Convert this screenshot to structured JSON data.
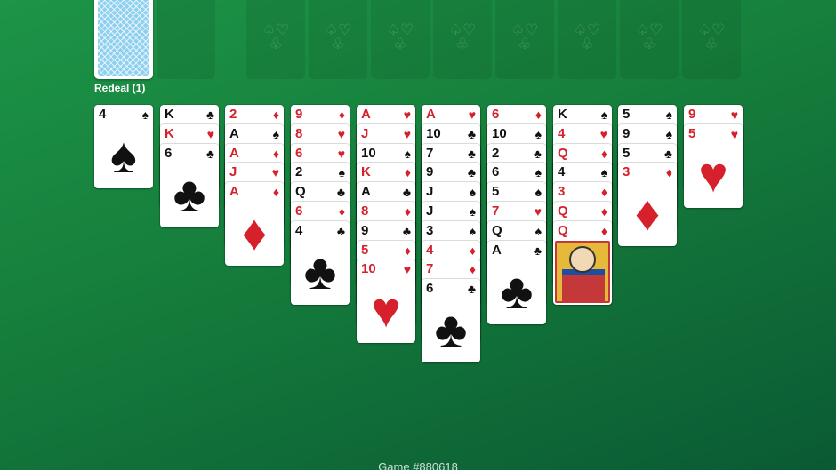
{
  "stock": {
    "redeal_label": "Redeal (1)"
  },
  "foundations": [
    {
      "symbol_top": "♤♡",
      "symbol_bottom": "♧"
    },
    {
      "symbol_top": "♤♡",
      "symbol_bottom": "♧"
    },
    {
      "symbol_top": "♤♡",
      "symbol_bottom": "♧"
    },
    {
      "symbol_top": "♤♡",
      "symbol_bottom": "♧"
    },
    {
      "symbol_top": "♤♡",
      "symbol_bottom": "♧"
    },
    {
      "symbol_top": "♤♡",
      "symbol_bottom": "♧"
    },
    {
      "symbol_top": "♤♡",
      "symbol_bottom": "♧"
    },
    {
      "symbol_top": "♤♡",
      "symbol_bottom": "♧"
    }
  ],
  "tableau": [
    [
      {
        "rank": "4",
        "suit": "♠",
        "color": "black"
      }
    ],
    [
      {
        "rank": "K",
        "suit": "♣",
        "color": "black"
      },
      {
        "rank": "K",
        "suit": "♥",
        "color": "red"
      },
      {
        "rank": "6",
        "suit": "♣",
        "color": "black"
      }
    ],
    [
      {
        "rank": "2",
        "suit": "♦",
        "color": "red"
      },
      {
        "rank": "A",
        "suit": "♠",
        "color": "black"
      },
      {
        "rank": "A",
        "suit": "♦",
        "color": "red"
      },
      {
        "rank": "J",
        "suit": "♥",
        "color": "red"
      },
      {
        "rank": "A",
        "suit": "♦",
        "color": "red"
      }
    ],
    [
      {
        "rank": "9",
        "suit": "♦",
        "color": "red"
      },
      {
        "rank": "8",
        "suit": "♥",
        "color": "red"
      },
      {
        "rank": "6",
        "suit": "♥",
        "color": "red"
      },
      {
        "rank": "2",
        "suit": "♠",
        "color": "black"
      },
      {
        "rank": "Q",
        "suit": "♣",
        "color": "black"
      },
      {
        "rank": "6",
        "suit": "♦",
        "color": "red"
      },
      {
        "rank": "4",
        "suit": "♣",
        "color": "black"
      }
    ],
    [
      {
        "rank": "A",
        "suit": "♥",
        "color": "red"
      },
      {
        "rank": "J",
        "suit": "♥",
        "color": "red"
      },
      {
        "rank": "10",
        "suit": "♠",
        "color": "black"
      },
      {
        "rank": "K",
        "suit": "♦",
        "color": "red"
      },
      {
        "rank": "A",
        "suit": "♣",
        "color": "black"
      },
      {
        "rank": "8",
        "suit": "♦",
        "color": "red"
      },
      {
        "rank": "9",
        "suit": "♣",
        "color": "black"
      },
      {
        "rank": "5",
        "suit": "♦",
        "color": "red"
      },
      {
        "rank": "10",
        "suit": "♥",
        "color": "red"
      }
    ],
    [
      {
        "rank": "A",
        "suit": "♥",
        "color": "red"
      },
      {
        "rank": "10",
        "suit": "♣",
        "color": "black"
      },
      {
        "rank": "7",
        "suit": "♣",
        "color": "black"
      },
      {
        "rank": "9",
        "suit": "♣",
        "color": "black"
      },
      {
        "rank": "J",
        "suit": "♠",
        "color": "black"
      },
      {
        "rank": "J",
        "suit": "♠",
        "color": "black"
      },
      {
        "rank": "3",
        "suit": "♠",
        "color": "black"
      },
      {
        "rank": "4",
        "suit": "♦",
        "color": "red"
      },
      {
        "rank": "7",
        "suit": "♦",
        "color": "red"
      },
      {
        "rank": "6",
        "suit": "♣",
        "color": "black"
      }
    ],
    [
      {
        "rank": "6",
        "suit": "♦",
        "color": "red"
      },
      {
        "rank": "10",
        "suit": "♠",
        "color": "black"
      },
      {
        "rank": "2",
        "suit": "♣",
        "color": "black"
      },
      {
        "rank": "6",
        "suit": "♠",
        "color": "black"
      },
      {
        "rank": "5",
        "suit": "♠",
        "color": "black"
      },
      {
        "rank": "7",
        "suit": "♥",
        "color": "red"
      },
      {
        "rank": "Q",
        "suit": "♠",
        "color": "black"
      },
      {
        "rank": "A",
        "suit": "♣",
        "color": "black"
      }
    ],
    [
      {
        "rank": "K",
        "suit": "♠",
        "color": "black"
      },
      {
        "rank": "4",
        "suit": "♥",
        "color": "red"
      },
      {
        "rank": "Q",
        "suit": "♦",
        "color": "red"
      },
      {
        "rank": "4",
        "suit": "♠",
        "color": "black"
      },
      {
        "rank": "3",
        "suit": "♦",
        "color": "red"
      },
      {
        "rank": "Q",
        "suit": "♦",
        "color": "red"
      },
      {
        "rank": "Q",
        "suit": "♦",
        "color": "red",
        "face": true
      }
    ],
    [
      {
        "rank": "5",
        "suit": "♠",
        "color": "black"
      },
      {
        "rank": "9",
        "suit": "♠",
        "color": "black"
      },
      {
        "rank": "5",
        "suit": "♣",
        "color": "black"
      },
      {
        "rank": "3",
        "suit": "♦",
        "color": "red"
      }
    ],
    [
      {
        "rank": "9",
        "suit": "♥",
        "color": "red"
      },
      {
        "rank": "5",
        "suit": "♥",
        "color": "red"
      }
    ]
  ],
  "colors": {
    "red": "#d6202b",
    "black": "#111111",
    "felt": "#16803c"
  },
  "footer": {
    "game_number": "Game #880618"
  }
}
